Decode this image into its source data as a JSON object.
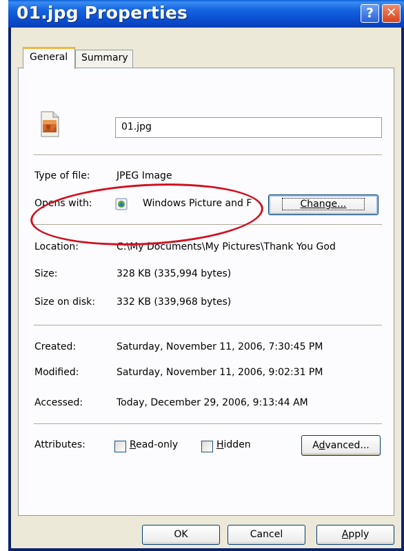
{
  "window": {
    "title": "01.jpg Properties",
    "help_glyph": "?",
    "close_glyph": "✕"
  },
  "tabs": [
    {
      "label": "General"
    },
    {
      "label": "Summary"
    }
  ],
  "file": {
    "name": "01.jpg"
  },
  "type_section": {
    "type_label": "Type of file:",
    "type_value": "JPEG Image",
    "opens_label": "Opens with:",
    "opens_value": "Windows Picture and F",
    "change_button": "Change..."
  },
  "location_section": {
    "location_label": "Location:",
    "location_value": "C:\\My Documents\\My Pictures\\Thank You God",
    "size_label": "Size:",
    "size_value": "328 KB (335,994 bytes)",
    "size_on_disk_label": "Size on disk:",
    "size_on_disk_value": "332 KB (339,968 bytes)"
  },
  "dates_section": {
    "created_label": "Created:",
    "created_value": "Saturday, November 11, 2006, 7:30:45 PM",
    "modified_label": "Modified:",
    "modified_value": "Saturday, November 11, 2006, 9:02:31 PM",
    "accessed_label": "Accessed:",
    "accessed_value": "Today, December 29, 2006, 9:13:44 AM"
  },
  "attributes": {
    "label": "Attributes:",
    "readonly_key": "R",
    "readonly_rest": "ead-only",
    "readonly_checked": false,
    "hidden_key": "H",
    "hidden_rest": "idden",
    "hidden_checked": false,
    "advanced_pre": "A",
    "advanced_key": "d",
    "advanced_rest": "vanced..."
  },
  "buttons": {
    "ok": "OK",
    "cancel": "Cancel",
    "apply_key": "A",
    "apply_rest": "pply"
  },
  "annotation": {
    "highlight_color": "#d01020"
  },
  "icons": {
    "file_icon": "jpeg-file-icon",
    "app_icon": "windows-picture-viewer-icon"
  }
}
